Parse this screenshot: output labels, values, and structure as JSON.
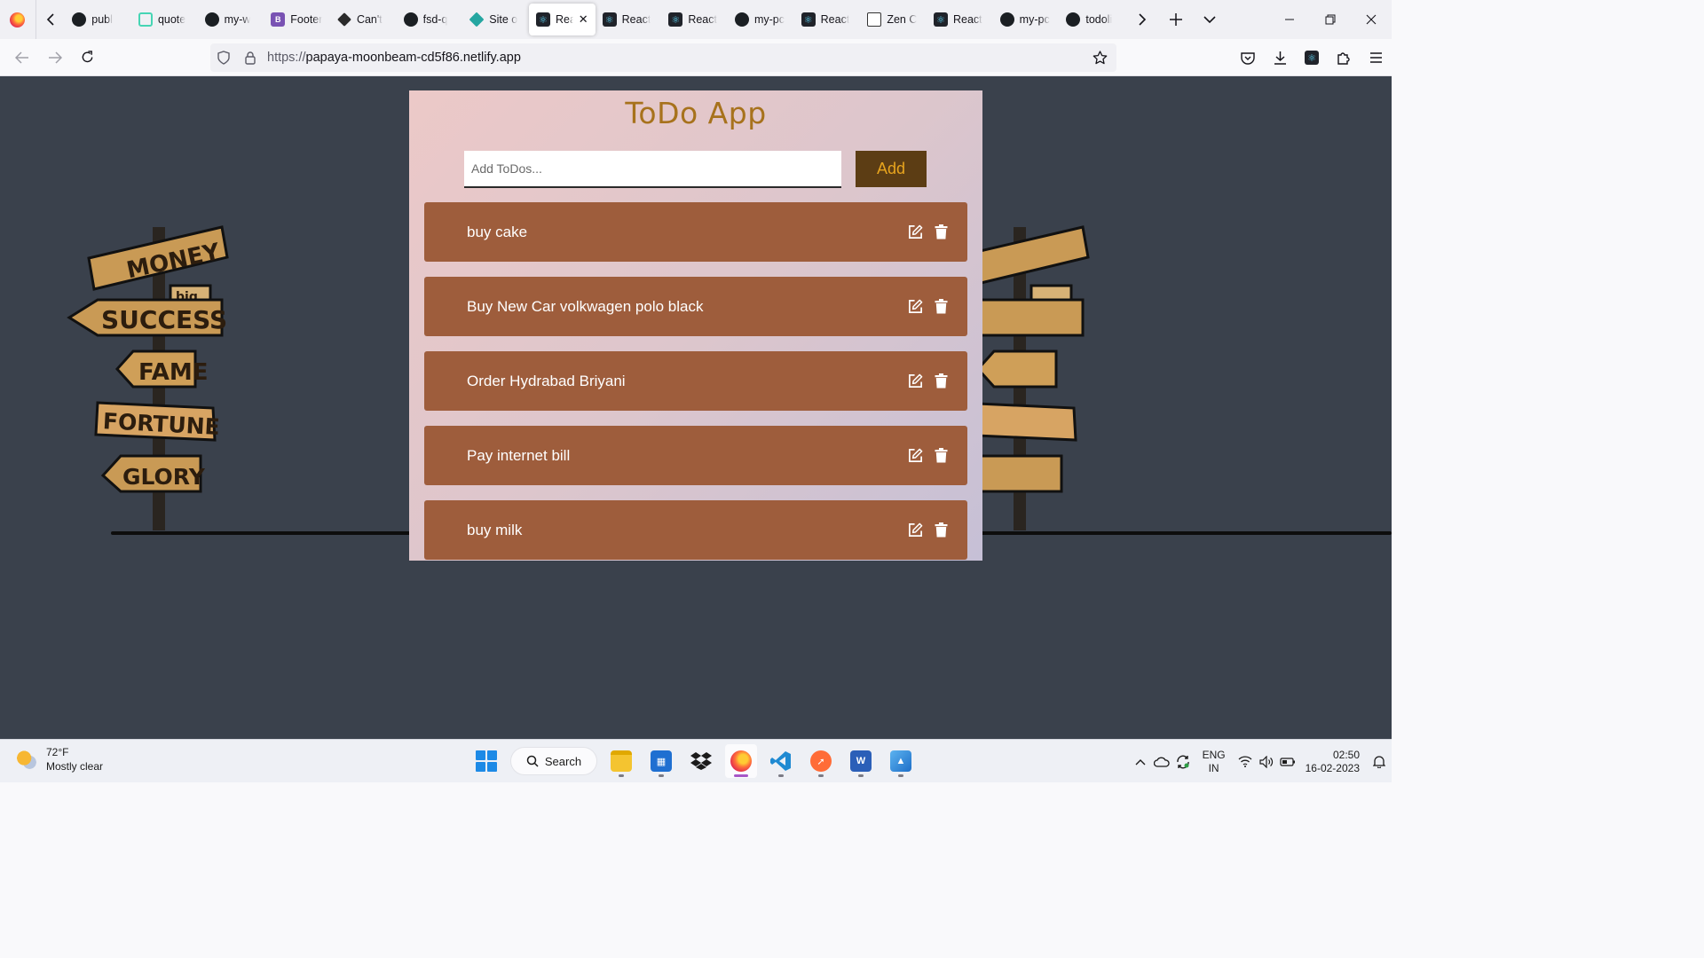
{
  "browser": {
    "tabs": [
      {
        "label": "publ",
        "icon": "github-icon",
        "kind": "gh"
      },
      {
        "label": "quote",
        "icon": "quote-generator-icon",
        "kind": "quote"
      },
      {
        "label": "my-w",
        "icon": "github-icon",
        "kind": "gh"
      },
      {
        "label": "Footer",
        "icon": "bootstrap-icon",
        "kind": "boot"
      },
      {
        "label": "Can't",
        "icon": "diamond-icon",
        "kind": "diamond"
      },
      {
        "label": "fsd-q",
        "icon": "github-icon",
        "kind": "gh"
      },
      {
        "label": "Site o",
        "icon": "netlify-icon",
        "kind": "netlify"
      },
      {
        "label": "Rea",
        "icon": "react-icon",
        "kind": "react",
        "active": true
      },
      {
        "label": "React",
        "icon": "react-icon",
        "kind": "react"
      },
      {
        "label": "React",
        "icon": "react-icon",
        "kind": "react"
      },
      {
        "label": "my-pc",
        "icon": "github-icon",
        "kind": "gh"
      },
      {
        "label": "React",
        "icon": "react-icon",
        "kind": "react"
      },
      {
        "label": "Zen C",
        "icon": "zen-class-icon",
        "kind": "zen"
      },
      {
        "label": "React",
        "icon": "react-icon",
        "kind": "react"
      },
      {
        "label": "my-pc",
        "icon": "github-icon",
        "kind": "gh"
      },
      {
        "label": "todoli",
        "icon": "github-icon",
        "kind": "gh"
      }
    ],
    "url_scheme": "https://",
    "url_host": "papaya-moonbeam-cd5f86.netlify.app"
  },
  "app": {
    "title": "ToDo App",
    "input_placeholder": "Add ToDos...",
    "add_label": "Add",
    "todos": [
      {
        "text": "buy cake"
      },
      {
        "text": "Buy New Car volkwagen polo black"
      },
      {
        "text": "Order Hydrabad Briyani"
      },
      {
        "text": "Pay internet bill"
      },
      {
        "text": "buy milk"
      }
    ],
    "signpost_words": [
      "MONEY",
      "big",
      "SUCCESS",
      "FAME",
      "FORTUNE",
      "GLORY"
    ]
  },
  "colors": {
    "page_background": "#3a414c",
    "title": "#a7721c",
    "add_button": "#5c3d14",
    "add_button_text": "#e8a51e",
    "todo_item": "#9e5d3c"
  },
  "taskbar": {
    "weather_temp": "72°F",
    "weather_desc": "Mostly clear",
    "search_label": "Search",
    "lang_top": "ENG",
    "lang_bottom": "IN",
    "time": "02:50",
    "date": "16-02-2023"
  }
}
